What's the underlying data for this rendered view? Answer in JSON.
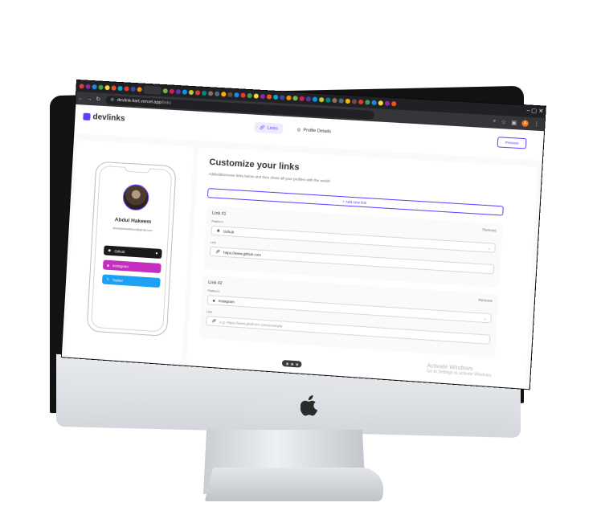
{
  "browser": {
    "url_host": "devlink-liart.vercel.app",
    "url_path": "/links",
    "tab_colors": [
      "#e53935",
      "#8e24aa",
      "#1e88e5",
      "#43a047",
      "#fdd835",
      "#f4511e",
      "#00acc1",
      "#e53935",
      "#3949ab",
      "#fb8c00",
      "#7cb342",
      "#d81b60",
      "#5e35b1",
      "#039be5",
      "#c0ca33",
      "#e53935",
      "#00897b",
      "#8d6e63",
      "#546e7a",
      "#ffb300",
      "#6d4c41",
      "#1e88e5",
      "#e53935",
      "#43a047",
      "#fdd835",
      "#8e24aa",
      "#f4511e",
      "#00acc1",
      "#3949ab",
      "#fb8c00",
      "#7cb342",
      "#d81b60",
      "#5e35b1",
      "#039be5",
      "#c0ca33",
      "#00897b",
      "#8d6e63",
      "#546e7a",
      "#ffb300",
      "#6d4c41",
      "#e53935",
      "#43a047",
      "#1e88e5",
      "#fdd835",
      "#8e24aa",
      "#f4511e"
    ],
    "profile_initial": "A"
  },
  "app": {
    "logo_text": "devlinks",
    "tabs": [
      {
        "label": "Links",
        "icon": "link-icon",
        "active": true
      },
      {
        "label": "Profile Details",
        "icon": "user-circle-icon",
        "active": false
      }
    ],
    "preview_label": "Preview"
  },
  "preview": {
    "name": "Abdul Hakeem",
    "email": "abdulabdulhakeem@gmail.com",
    "links": [
      {
        "label": "Github",
        "color": "#1a1a1a",
        "icon": "github-icon"
      },
      {
        "label": "Instagram",
        "color": "#c42fbf",
        "icon": "instagram-icon"
      },
      {
        "label": "Twitter",
        "color": "#1da1f2",
        "icon": "x-icon"
      }
    ]
  },
  "editor": {
    "title": "Customize your links",
    "subtitle": "Add/edit/remove links below and then share all your profiles with the world!",
    "add_new_label": "+ Add new link",
    "links": [
      {
        "title": "Link #1",
        "remove_label": "Remove",
        "platform_label": "Platform",
        "platform_value": "Github",
        "link_label": "Link",
        "link_value": "https://www.github.com",
        "link_placeholder": ""
      },
      {
        "title": "Link #2",
        "remove_label": "Remove",
        "platform_label": "Platform",
        "platform_value": "Instagram",
        "link_label": "Link",
        "link_value": "",
        "link_placeholder": "e.g. https://www.platform.com/example"
      }
    ]
  },
  "watermark": {
    "line1": "Activate Windows",
    "line2": "Go to Settings to activate Windows."
  }
}
